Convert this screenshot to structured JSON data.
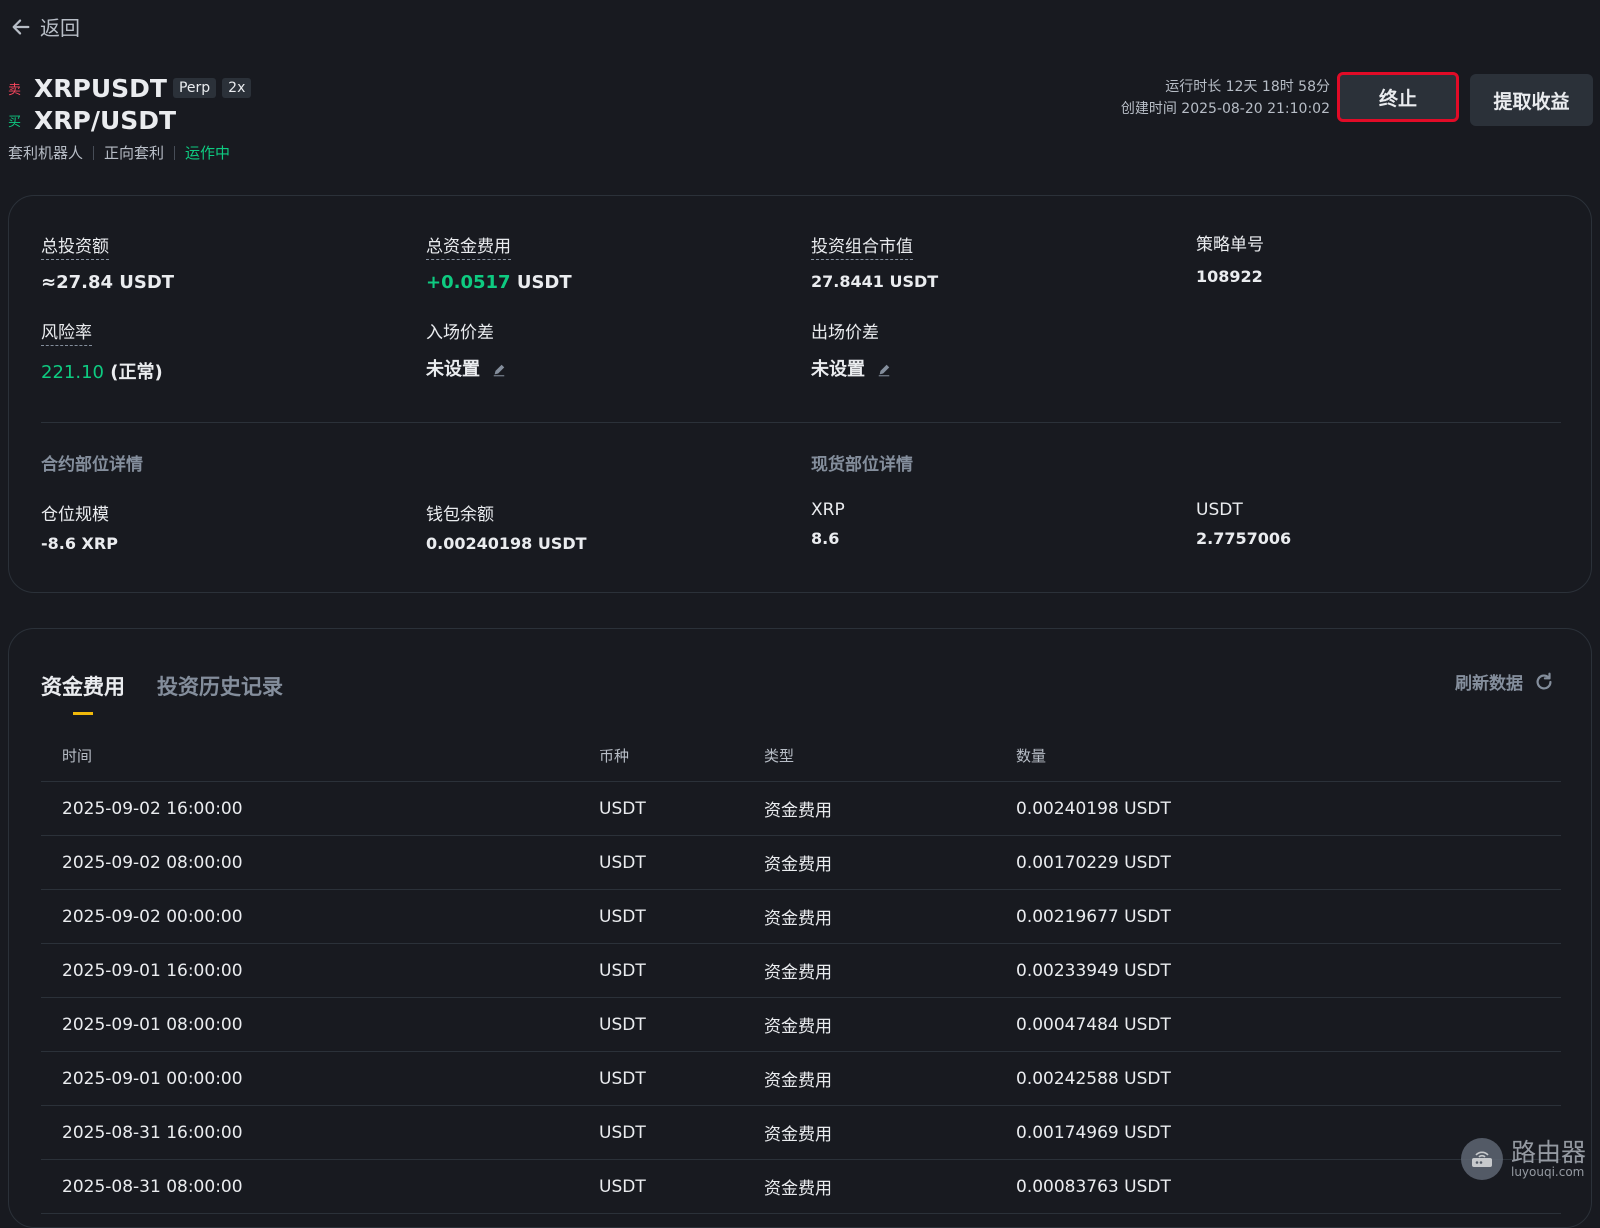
{
  "nav": {
    "back_label": "返回"
  },
  "header": {
    "sell_tag": "卖",
    "buy_tag": "买",
    "perp_symbol": "XRPUSDT",
    "perp_badge": "Perp",
    "leverage_badge": "2x",
    "spot_symbol": "XRP/USDT",
    "bot_type": "套利机器人",
    "strategy": "正向套利",
    "status": "运作中",
    "runtime": "运行时长 12天 18时 58分",
    "created": "创建时间 2025-08-20 21:10:02",
    "stop_label": "终止",
    "withdraw_label": "提取收益"
  },
  "summary": {
    "total_invest_label": "总投资额",
    "total_invest_value": "≈27.84 USDT",
    "funding_label": "总资金费用",
    "funding_value": "+0.0517",
    "funding_unit": "USDT",
    "portfolio_label": "投资组合市值",
    "portfolio_value": "27.8441 USDT",
    "order_id_label": "策略单号",
    "order_id_value": "108922",
    "risk_label": "风险率",
    "risk_value": "221.10",
    "risk_status": "(正常)",
    "entry_label": "入场价差",
    "entry_value": "未设置",
    "exit_label": "出场价差",
    "exit_value": "未设置"
  },
  "positions": {
    "futures_title": "合约部位详情",
    "spot_title": "现货部位详情",
    "size_label": "仓位规模",
    "size_value": "-8.6 XRP",
    "wallet_label": "钱包余额",
    "wallet_value": "0.00240198 USDT",
    "xrp_label": "XRP",
    "xrp_value": "8.6",
    "usdt_label": "USDT",
    "usdt_value": "2.7757006"
  },
  "records": {
    "tab_funding": "资金费用",
    "tab_history": "投资历史记录",
    "refresh_label": "刷新数据",
    "columns": [
      "时间",
      "币种",
      "类型",
      "数量"
    ],
    "rows": [
      [
        "2025-09-02 16:00:00",
        "USDT",
        "资金费用",
        "0.00240198 USDT"
      ],
      [
        "2025-09-02 08:00:00",
        "USDT",
        "资金费用",
        "0.00170229 USDT"
      ],
      [
        "2025-09-02 00:00:00",
        "USDT",
        "资金费用",
        "0.00219677 USDT"
      ],
      [
        "2025-09-01 16:00:00",
        "USDT",
        "资金费用",
        "0.00233949 USDT"
      ],
      [
        "2025-09-01 08:00:00",
        "USDT",
        "资金费用",
        "0.00047484 USDT"
      ],
      [
        "2025-09-01 00:00:00",
        "USDT",
        "资金费用",
        "0.00242588 USDT"
      ],
      [
        "2025-08-31 16:00:00",
        "USDT",
        "资金费用",
        "0.00174969 USDT"
      ],
      [
        "2025-08-31 08:00:00",
        "USDT",
        "资金费用",
        "0.00083763 USDT"
      ]
    ]
  },
  "watermark": {
    "name": "路由器",
    "url": "luyouqi.com"
  },
  "colors": {
    "background": "#181a20",
    "green": "#0ecb81",
    "red": "#f6465d",
    "accent": "#f0b90b",
    "highlight_border": "#e10b27"
  }
}
